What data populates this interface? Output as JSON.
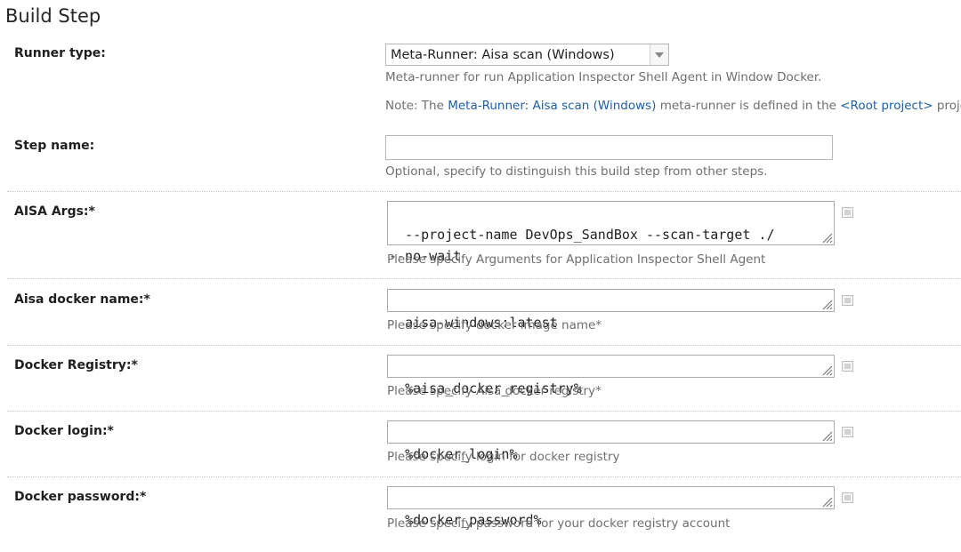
{
  "page_title": "Build Step",
  "runner_type": {
    "label": "Runner type:",
    "selected": "Meta-Runner: Aisa scan (Windows)",
    "description": "Meta-runner for run Application Inspector Shell Agent in Window Docker.",
    "note_prefix": "Note: The ",
    "note_link1": "Meta-Runner: Aisa scan (Windows)",
    "note_middle": " meta-runner is defined in the ",
    "note_link2": "<Root project>",
    "note_suffix": " project."
  },
  "step_name": {
    "label": "Step name:",
    "value": "",
    "hint": "Optional, specify to distinguish this build step from other steps."
  },
  "aisa_args": {
    "label": "AISA Args:*",
    "value": "--project-name DevOps_SandBox --scan-target ./\n--no-wait",
    "hint": "Please specify Arguments for Application Inspector Shell Agent"
  },
  "docker_name": {
    "label": "Aisa docker name:*",
    "value": "aisa-windows:latest",
    "hint": "Please specify docker image name*"
  },
  "docker_registry": {
    "label": "Docker Registry:*",
    "value": "%aisa_docker_registry%",
    "hint": "Please specify Aisa docker registry*"
  },
  "docker_login": {
    "label": "Docker login:*",
    "value": "%docker_login%",
    "hint": "Please specify login for docker registry"
  },
  "docker_password": {
    "label": "Docker password:*",
    "value": "%docker_password%",
    "hint": "Please specify password for your docker registry account"
  },
  "icons": {
    "edit": "edit-parameter-icon",
    "resize": "resize-grip-icon",
    "dropdown": "chevron-down-icon"
  }
}
